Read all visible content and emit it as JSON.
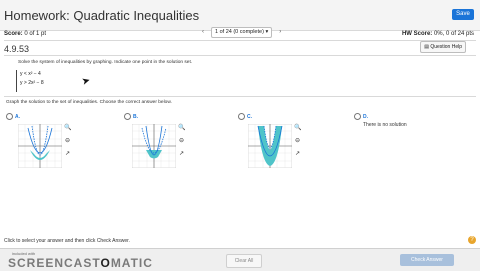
{
  "app": {
    "title": "Homework: Quadratic Inequalities",
    "save_label": "Save"
  },
  "status": {
    "score_label": "Score:",
    "score_value": "0 of 1 pt",
    "pager_text": "1 of 24 (0 complete)",
    "prev_icon": "chevron-left-icon",
    "next_icon": "chevron-right-icon",
    "hw_score_label": "HW Score:",
    "hw_score_value": "0%, 0 of 24 pts"
  },
  "question": {
    "number": "4.9.53",
    "help_label": "Question Help",
    "instruction": "Solve the system of inequalities by graphing. Indicate one point in the solution set.",
    "system": [
      "y < x² − 4",
      "y > 2x² − 8"
    ],
    "graph_instruction": "Graph the solution to the set of inequalities. Choose the correct answer below."
  },
  "options": [
    {
      "label": "A.",
      "icons": [
        "zoom-in-icon",
        "zoom-out-icon",
        "expand-icon"
      ]
    },
    {
      "label": "B.",
      "icons": [
        "zoom-in-icon",
        "zoom-out-icon",
        "expand-icon"
      ]
    },
    {
      "label": "C.",
      "icons": [
        "zoom-in-icon",
        "zoom-out-icon",
        "expand-icon"
      ]
    },
    {
      "label": "D.",
      "text": "There is no solution"
    }
  ],
  "footer": {
    "hint": "Click to select your answer and then click Check Answer.",
    "clear_all": "Clear All",
    "check_answer": "Check Answer",
    "help_icon": "question-mark-icon"
  },
  "watermark": {
    "pre": "included with",
    "name_light": "SCREENCAST",
    "name_dark": "O",
    "name_tail": "MATIC"
  },
  "colors": {
    "accent": "#1a74d8",
    "shade": "#4fc4c9",
    "topbar": "#f4f4f4"
  }
}
